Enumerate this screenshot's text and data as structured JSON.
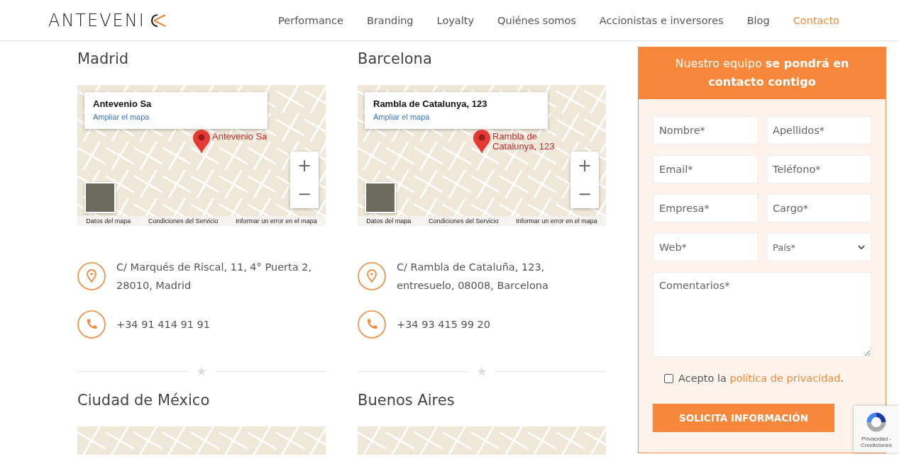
{
  "header": {
    "logo": "ANTEVENI",
    "nav": [
      {
        "label": "Performance",
        "selected": false
      },
      {
        "label": "Branding",
        "selected": false
      },
      {
        "label": "Loyalty",
        "selected": false
      },
      {
        "label": "Quiénes somos",
        "selected": false
      },
      {
        "label": "Accionistas e inversores",
        "selected": false
      },
      {
        "label": "Blog",
        "selected": false
      },
      {
        "label": "Contacto",
        "selected": true
      }
    ]
  },
  "offices": [
    {
      "city": "Madrid",
      "map": {
        "place": "Antevenio Sa",
        "link": "Ampliar el mapa",
        "marker_label": "Antevenio Sa",
        "zoom_in": "+",
        "zoom_out": "−",
        "footer": [
          "Datos del mapa",
          "Condiciones del Servicio",
          "Informar un error en el mapa"
        ]
      },
      "address": "C/ Marqués de Riscal, 11, 4° Puerta 2, 28010, Madrid",
      "phone": "+34 91 414 91 91"
    },
    {
      "city": "Barcelona",
      "map": {
        "place": "Rambla de Catalunya, 123",
        "link": "Ampliar el mapa",
        "marker_label": "Rambla de Catalunya, 123",
        "zoom_in": "+",
        "zoom_out": "−",
        "footer": [
          "Datos del mapa",
          "Condiciones del Servicio",
          "Informar un error en el mapa"
        ]
      },
      "address": "C/ Rambla de Cataluña, 123, entresuelo, 08008, Barcelona",
      "phone": "+34 93 415 99 20"
    }
  ],
  "offices_next": [
    {
      "city": "Ciudad de México"
    },
    {
      "city": "Buenos Aires"
    }
  ],
  "form": {
    "title": "Nuestro equipo **se pondrá en contacto contigo**",
    "fields": [
      {
        "kind": "input",
        "placeholder": "Nombre*"
      },
      {
        "kind": "input",
        "placeholder": "Apellidos*"
      },
      {
        "kind": "input",
        "placeholder": "Email*"
      },
      {
        "kind": "input",
        "placeholder": "Teléfono*"
      },
      {
        "kind": "input",
        "placeholder": "Empresa*"
      },
      {
        "kind": "input",
        "placeholder": "Cargo*"
      },
      {
        "kind": "input",
        "placeholder": "Web*"
      },
      {
        "kind": "select",
        "placeholder": "País*"
      },
      {
        "kind": "textarea",
        "placeholder": "Comentarios*"
      }
    ],
    "consent": {
      "checked": false,
      "before": "Acepto la",
      "link": "política de privacidad",
      "after": "."
    },
    "submit": "SOLICITA INFORMACIÓN"
  },
  "recaptcha": {
    "text": "Privacidad - Condiciones"
  }
}
